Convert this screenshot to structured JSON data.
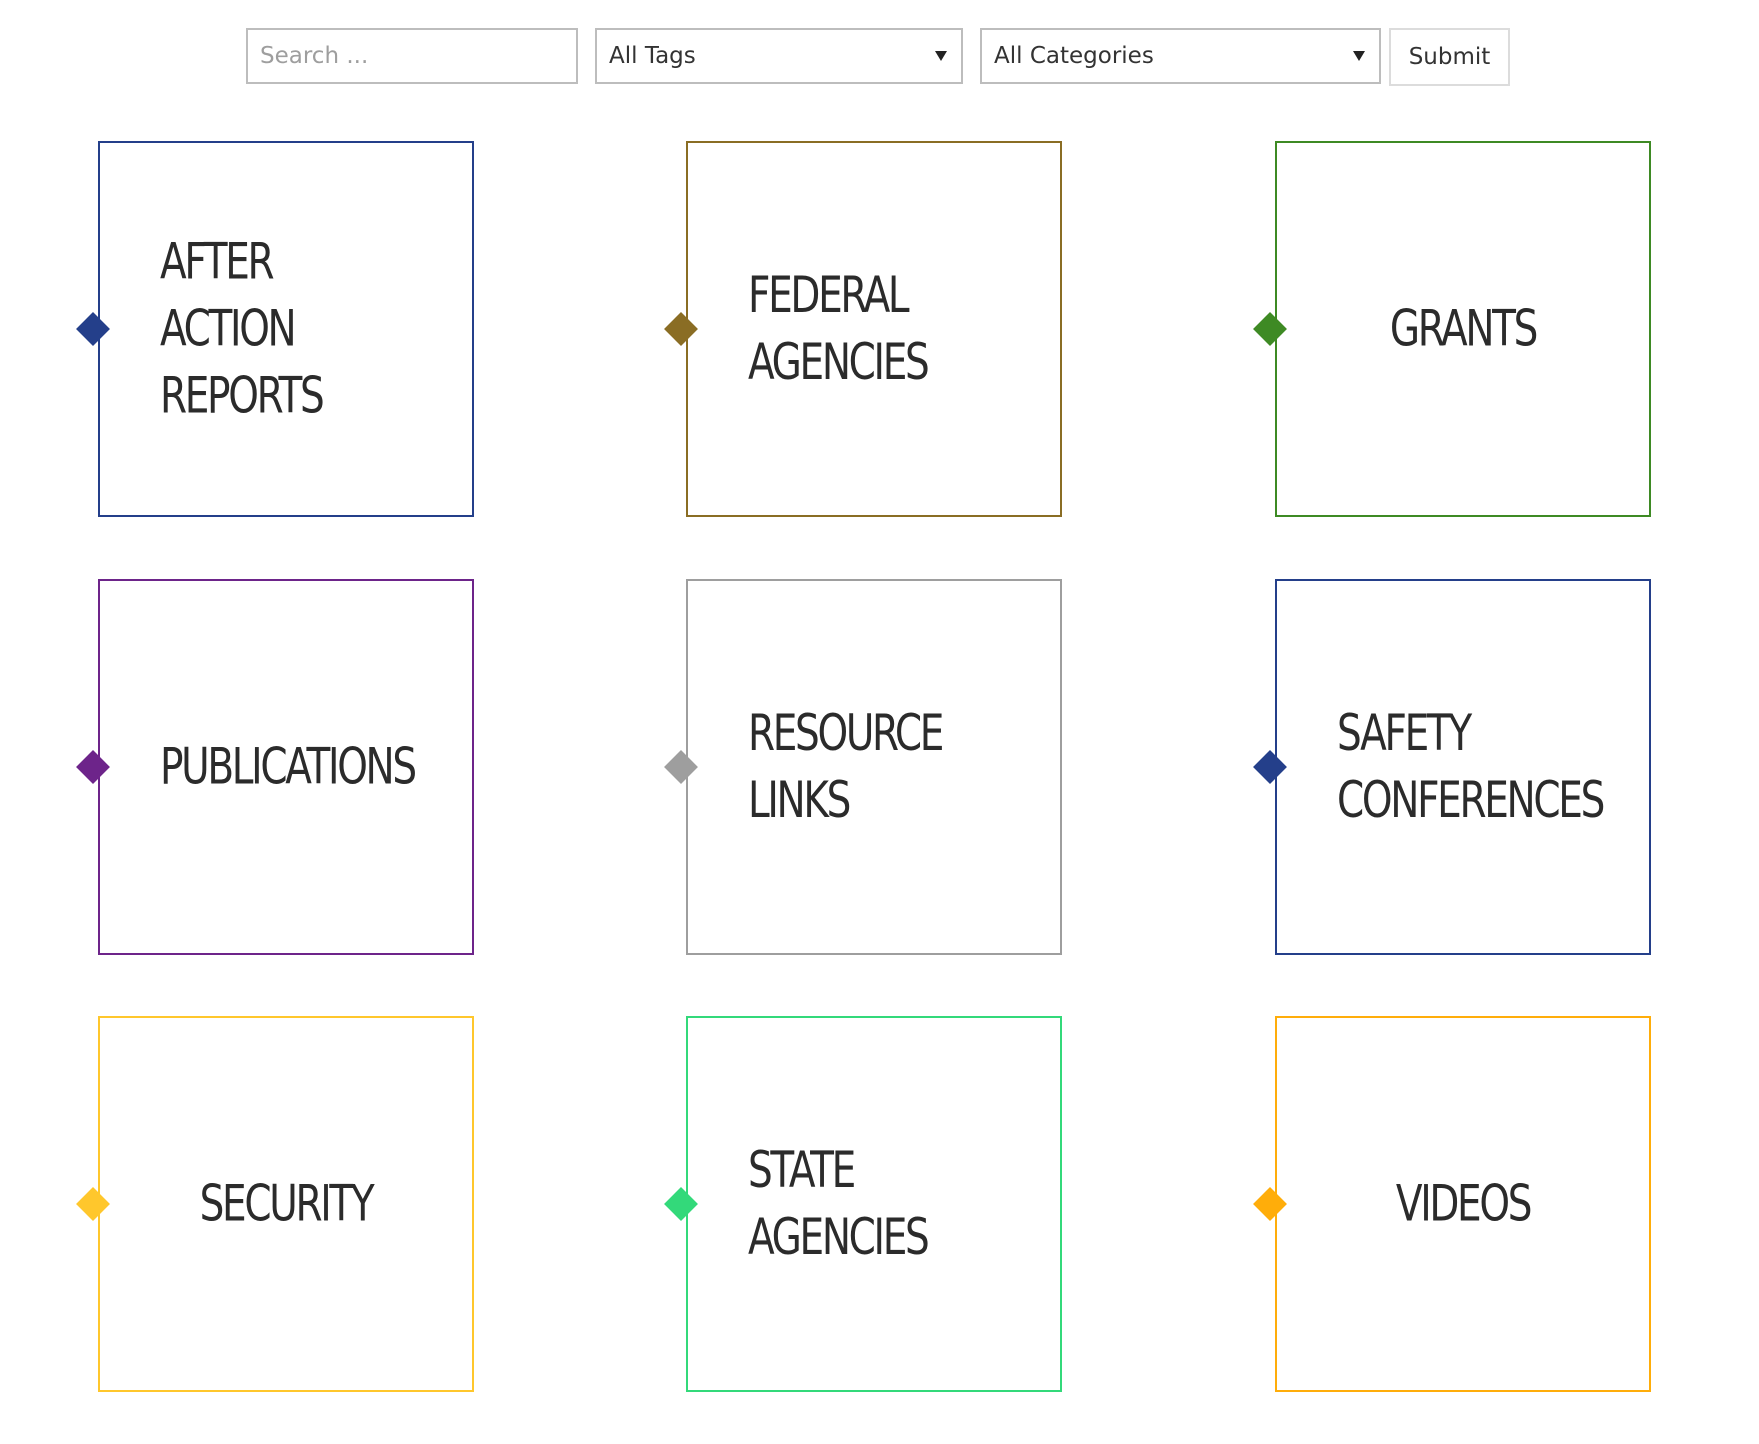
{
  "filters": {
    "search_placeholder": "Search ...",
    "tags_selected": "All Tags",
    "categories_selected": "All Categories",
    "submit_label": "Submit"
  },
  "tiles": [
    {
      "lines": [
        "AFTER ACTION",
        "REPORTS"
      ],
      "color": "#243f8a",
      "align": "left"
    },
    {
      "lines": [
        "FEDERAL",
        "AGENCIES"
      ],
      "color": "#8a6d24",
      "align": "left"
    },
    {
      "lines": [
        "GRANTS"
      ],
      "color": "#3e8a24",
      "align": "center"
    },
    {
      "lines": [
        "PUBLICATIONS"
      ],
      "color": "#6d248a",
      "align": "left"
    },
    {
      "lines": [
        "RESOURCE",
        "LINKS"
      ],
      "color": "#9e9e9e",
      "align": "left"
    },
    {
      "lines": [
        "SAFETY",
        "CONFERENCES"
      ],
      "color": "#243f8a",
      "align": "left"
    },
    {
      "lines": [
        "SECURITY"
      ],
      "color": "#ffc72c",
      "align": "center"
    },
    {
      "lines": [
        "STATE",
        "AGENCIES"
      ],
      "color": "#33d97a",
      "align": "left"
    },
    {
      "lines": [
        "VIDEOS"
      ],
      "color": "#ffad0a",
      "align": "center"
    }
  ]
}
